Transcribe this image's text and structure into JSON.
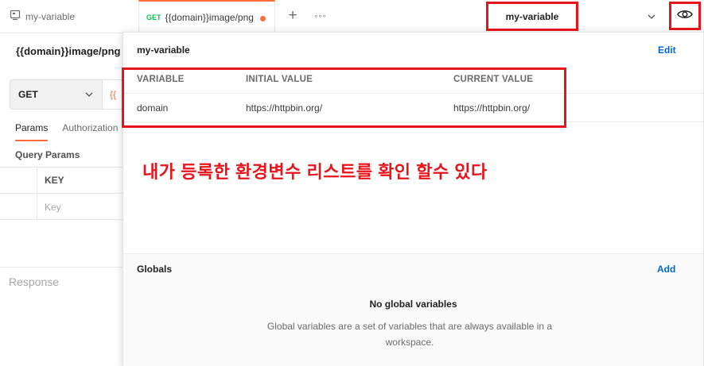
{
  "tabs": {
    "env_tab_label": "my-variable",
    "request_tab": {
      "method": "GET",
      "title": "{{domain}}image/png"
    },
    "plus_symbol": "+",
    "more_symbol": "◦◦◦"
  },
  "environment_selector": {
    "selected": "my-variable"
  },
  "request": {
    "title": "{{domain}}image/png",
    "method": "GET",
    "url_peek": "{{",
    "tabs": [
      "Params",
      "Authorization"
    ],
    "active_tab": "Params",
    "query_params_label": "Query Params",
    "table": {
      "key_header": "KEY",
      "key_placeholder": "Key"
    },
    "response_label": "Response"
  },
  "popover": {
    "environment_name": "my-variable",
    "edit_label": "Edit",
    "columns": [
      "VARIABLE",
      "INITIAL VALUE",
      "CURRENT VALUE"
    ],
    "rows": [
      {
        "variable": "domain",
        "initial_value": "https://httpbin.org/",
        "current_value": "https://httpbin.org/"
      }
    ],
    "annotation": "내가 등록한 환경변수 리스트를 확인 할수 있다",
    "globals": {
      "title": "Globals",
      "add_label": "Add",
      "empty_title": "No global variables",
      "empty_description": "Global variables are a set of variables that are always available in a workspace."
    }
  },
  "colors": {
    "accent_orange": "#ff6c37",
    "link_blue": "#0265d2",
    "annotation_red": "#e8141c",
    "method_get_green": "#0cbb52"
  },
  "icons": [
    "environment-icon",
    "eye-icon",
    "chevron-down-icon",
    "plus-icon",
    "more-icon"
  ]
}
